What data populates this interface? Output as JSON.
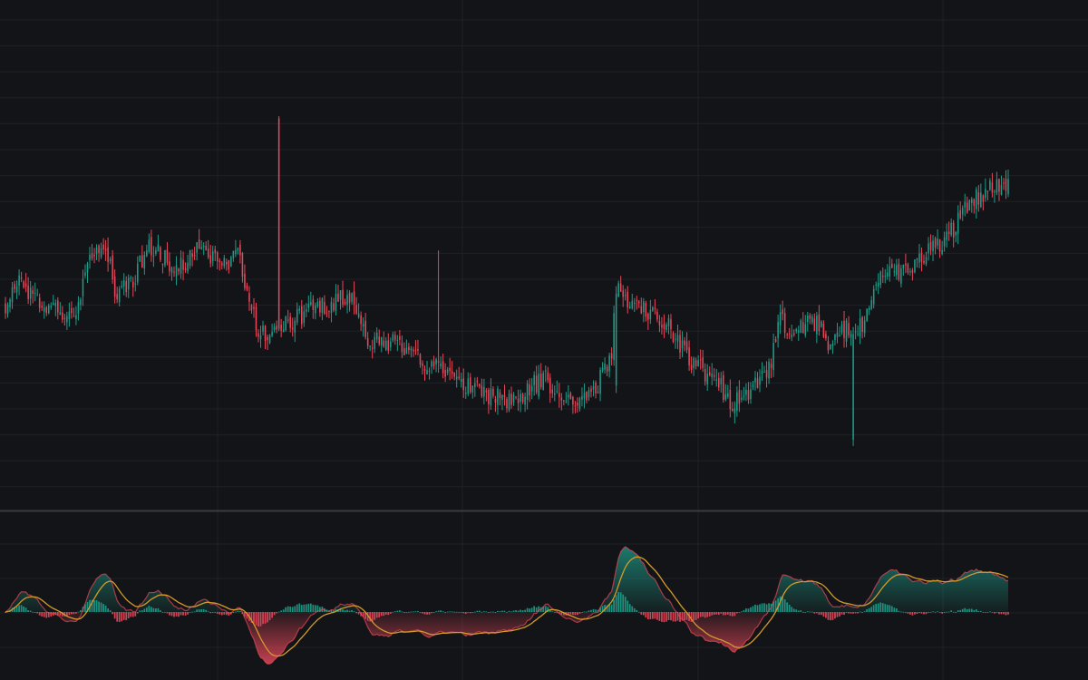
{
  "theme": {
    "background": "#131417",
    "grid": "#1f2126",
    "separator": "#3a3c42",
    "up": "#1e9c8a",
    "down": "#e5485a",
    "signal": "#d39a2a"
  },
  "chart_data": [
    {
      "type": "candlestick",
      "grid": true,
      "x_axis_labels_shown": false,
      "y_axis_labels_shown": false,
      "x": [
        0,
        1,
        2,
        3,
        4,
        5,
        6,
        7,
        8,
        9,
        10,
        11,
        12,
        13,
        14,
        15,
        16,
        17,
        18,
        19,
        20,
        21,
        22,
        23,
        24,
        25,
        26,
        27,
        28,
        29,
        30,
        31,
        32,
        33,
        34,
        35,
        36,
        37,
        38,
        39,
        40,
        41,
        42,
        43,
        44,
        45,
        46,
        47,
        48,
        49,
        50,
        51,
        52,
        53,
        54,
        55,
        56,
        57,
        58,
        59,
        60,
        61,
        62,
        63,
        64,
        65,
        66,
        67,
        68,
        69,
        70,
        71,
        72,
        73,
        74,
        75,
        76,
        77,
        78,
        79,
        80,
        81,
        82,
        83,
        84,
        85,
        86,
        87,
        88,
        89,
        90,
        91,
        92,
        93,
        94,
        95,
        96,
        97,
        98,
        99,
        100,
        101,
        102,
        103,
        104,
        105,
        106,
        107,
        108,
        109,
        110,
        111,
        112,
        113,
        114,
        115,
        116,
        117,
        118,
        119,
        120,
        121,
        122,
        123,
        124,
        125,
        126,
        127,
        128,
        129,
        130,
        131,
        132,
        133,
        134,
        135,
        136,
        137,
        138,
        139,
        140,
        141,
        142,
        143,
        144,
        145,
        146,
        147,
        148,
        149,
        150,
        151,
        152,
        153,
        154,
        155,
        156,
        157,
        158,
        159,
        160,
        161,
        162,
        163,
        164,
        165,
        166,
        167,
        168,
        169,
        170,
        171,
        172,
        173,
        174,
        175,
        176,
        177,
        178,
        179,
        180,
        181,
        182,
        183,
        184,
        185,
        186,
        187,
        188,
        189,
        190,
        191,
        192,
        193,
        194,
        195,
        196,
        197,
        198,
        199,
        200,
        201,
        202,
        203,
        204,
        205,
        206,
        207,
        208,
        209,
        210,
        211,
        212,
        213,
        214,
        215,
        216,
        217,
        218,
        219,
        220,
        221,
        222,
        223,
        224,
        225,
        226,
        227,
        228,
        229,
        230,
        231,
        232,
        233,
        234,
        235,
        236,
        237,
        238,
        239,
        240,
        241,
        242,
        243,
        244,
        245,
        246,
        247,
        248,
        249,
        250,
        251,
        252,
        253,
        254,
        255,
        256,
        257,
        258,
        259,
        260,
        261,
        262,
        263,
        264,
        265,
        266,
        267,
        268,
        269,
        270,
        271,
        272,
        273,
        274,
        275,
        276,
        277,
        278,
        279,
        280,
        281,
        282,
        283,
        284,
        285,
        286,
        287,
        288,
        289,
        290,
        291,
        292,
        293,
        294,
        295,
        296,
        297,
        298,
        299,
        300,
        301,
        302,
        303,
        304,
        305,
        306,
        307,
        308,
        309,
        310,
        311,
        312,
        313,
        314,
        315,
        316,
        317,
        318,
        319,
        320,
        321,
        322,
        323,
        324,
        325,
        326,
        327,
        328,
        329,
        330,
        331,
        332,
        333,
        334,
        335,
        336,
        337,
        338,
        339,
        340,
        341,
        342,
        343,
        344,
        345,
        346,
        347,
        348,
        349,
        350,
        351,
        352,
        353,
        354,
        355,
        356,
        357,
        358,
        359,
        360,
        361,
        362,
        363,
        364,
        365,
        366,
        367,
        368,
        369,
        370,
        371,
        372,
        373,
        374,
        375,
        376,
        377,
        378,
        379,
        380,
        381,
        382,
        383,
        384,
        385,
        386,
        387,
        388,
        389,
        390,
        391,
        392,
        393,
        394,
        395,
        396,
        397,
        398,
        399,
        400,
        401,
        402,
        403,
        404,
        405,
        406,
        407,
        408,
        409,
        410,
        411,
        412,
        413,
        414,
        415,
        416,
        417,
        418,
        419,
        420,
        421,
        422,
        423,
        424,
        425,
        426,
        427,
        428,
        429,
        430,
        431,
        432,
        433,
        434,
        435,
        436,
        437,
        438,
        439,
        440
      ],
      "anchor_path": [
        [
          0,
          58
        ],
        [
          6,
          69
        ],
        [
          12,
          63
        ],
        [
          18,
          58
        ],
        [
          24,
          59
        ],
        [
          30,
          57
        ],
        [
          34,
          66
        ],
        [
          36,
          76
        ],
        [
          44,
          80
        ],
        [
          48,
          64
        ],
        [
          56,
          68
        ],
        [
          62,
          78
        ],
        [
          70,
          75
        ],
        [
          74,
          71
        ],
        [
          80,
          73
        ],
        [
          84,
          80
        ],
        [
          96,
          72
        ],
        [
          102,
          76
        ],
        [
          106,
          63
        ],
        [
          112,
          52
        ],
        [
          120,
          53
        ],
        [
          126,
          56
        ],
        [
          140,
          61
        ],
        [
          152,
          63
        ],
        [
          156,
          56
        ],
        [
          158,
          49
        ],
        [
          170,
          50
        ],
        [
          176,
          46
        ],
        [
          182,
          44
        ],
        [
          190,
          41
        ],
        [
          198,
          38
        ],
        [
          204,
          35
        ],
        [
          210,
          34
        ],
        [
          220,
          32
        ],
        [
          228,
          34
        ],
        [
          236,
          39
        ],
        [
          242,
          33
        ],
        [
          252,
          32
        ],
        [
          260,
          37
        ],
        [
          266,
          46
        ],
        [
          268,
          65
        ],
        [
          278,
          60
        ],
        [
          290,
          56
        ],
        [
          296,
          48
        ],
        [
          302,
          43
        ],
        [
          312,
          38
        ],
        [
          318,
          31
        ],
        [
          326,
          34
        ],
        [
          336,
          43
        ],
        [
          340,
          57
        ],
        [
          344,
          52
        ],
        [
          356,
          56
        ],
        [
          362,
          48
        ],
        [
          368,
          53
        ],
        [
          376,
          55
        ],
        [
          382,
          68
        ],
        [
          396,
          72
        ],
        [
          412,
          80
        ],
        [
          424,
          92
        ],
        [
          438,
          98
        ],
        [
          440,
          96
        ]
      ],
      "gaps": [
        [
          120,
          64
        ],
        [
          268,
          -22
        ],
        [
          372,
          -32
        ]
      ]
    },
    {
      "type": "macd",
      "series": [
        {
          "role": "histogram",
          "color_up": "#1e9c8a",
          "color_down": "#e5485a"
        },
        {
          "role": "macd_line",
          "color": "#e5485a"
        },
        {
          "role": "signal_line",
          "color": "#d39a2a"
        }
      ]
    }
  ]
}
